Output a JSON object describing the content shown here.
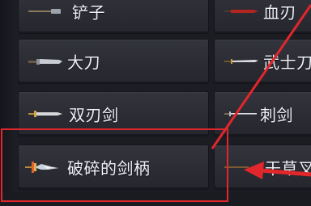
{
  "weapons_left": [
    {
      "label": "铲子",
      "icon": "shovel-icon"
    },
    {
      "label": "大刀",
      "icon": "big-blade-icon"
    },
    {
      "label": "双刃剑",
      "icon": "double-edged-sword-icon"
    },
    {
      "label": "破碎的剑柄",
      "icon": "broken-sword-hilt-icon"
    }
  ],
  "weapons_right": [
    {
      "label": "血刃",
      "icon": "blood-blade-icon"
    },
    {
      "label": "武士刀",
      "icon": "katana-icon"
    },
    {
      "label": "刺剑",
      "icon": "rapier-icon"
    },
    {
      "label": "干草叉",
      "icon": "pitchfork-icon"
    }
  ],
  "annotation": {
    "color": "#e1262c",
    "target": "破碎的剑柄"
  }
}
